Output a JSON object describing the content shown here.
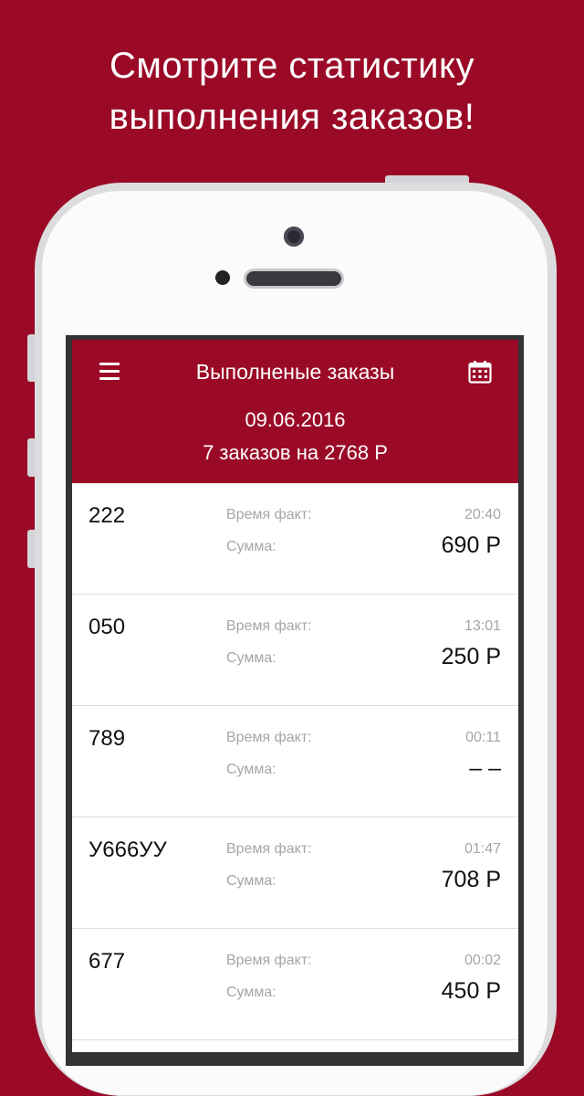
{
  "promo": {
    "line1": "Смотрите статистику",
    "line2": "выполнения заказов!"
  },
  "colors": {
    "brand": "#9a0a26",
    "header_text": "#ffffff",
    "muted_label": "#a6a6a6"
  },
  "header": {
    "menu_icon": "hamburger-menu-icon",
    "title": "Выполненые заказы",
    "calendar_icon": "calendar-icon",
    "date": "09.06.2016",
    "summary": "7 заказов на 2768 Р"
  },
  "orders": [
    {
      "number": "222",
      "time_label": "Время факт:",
      "time": "20:40",
      "sum_label": "Сумма:",
      "sum": "690 Р"
    },
    {
      "number": "050",
      "time_label": "Время факт:",
      "time": "13:01",
      "sum_label": "Сумма:",
      "sum": "250 Р"
    },
    {
      "number": "789",
      "time_label": "Время факт:",
      "time": "00:11",
      "sum_label": "Сумма:",
      "sum": "– –"
    },
    {
      "number": "У666УУ",
      "time_label": "Время факт:",
      "time": "01:47",
      "sum_label": "Сумма:",
      "sum": "708 Р"
    },
    {
      "number": "677",
      "time_label": "Время факт:",
      "time": "00:02",
      "sum_label": "Сумма:",
      "sum": "450 Р"
    }
  ]
}
